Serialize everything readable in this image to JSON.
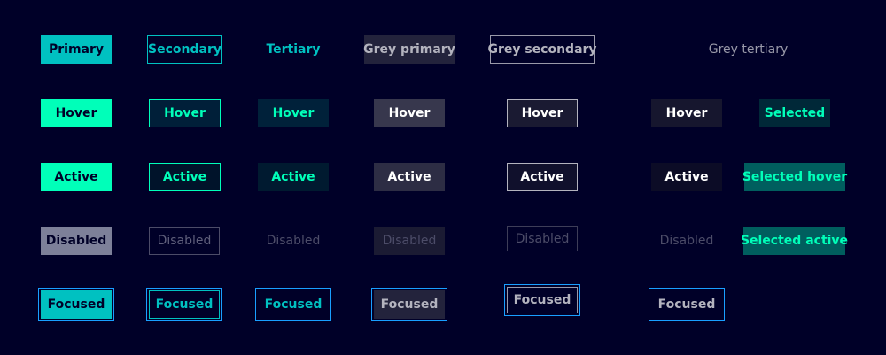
{
  "colors": {
    "background": "#000028",
    "primary": "#00c1c1",
    "primary_hover": "#00ffb9",
    "focus_outline": "#199fff",
    "disabled": "#7d8099"
  },
  "buttons": {
    "primary": {
      "default": "Primary",
      "hover": "Hover",
      "active": "Active",
      "disabled": "Disabled",
      "focused": "Focused"
    },
    "secondary": {
      "default": "Secondary",
      "hover": "Hover",
      "active": "Active",
      "disabled": "Disabled",
      "focused": "Focused"
    },
    "tertiary": {
      "default": "Tertiary",
      "hover": "Hover",
      "active": "Active",
      "disabled": "Disabled",
      "focused": "Focused"
    },
    "grey_primary": {
      "default": "Grey primary",
      "hover": "Hover",
      "active": "Active",
      "disabled": "Disabled",
      "focused": "Focused"
    },
    "grey_secondary": {
      "default": "Grey secondary",
      "hover": "Hover",
      "active": "Active",
      "disabled": "Disabled",
      "focused": "Focused"
    },
    "grey_tertiary": {
      "default": "Grey tertiary",
      "hover": "Hover",
      "active": "Active",
      "disabled": "Disabled",
      "focused": "Focused"
    },
    "selected": {
      "default": "Selected",
      "hover": "Selected hover",
      "active": "Selected active"
    }
  }
}
